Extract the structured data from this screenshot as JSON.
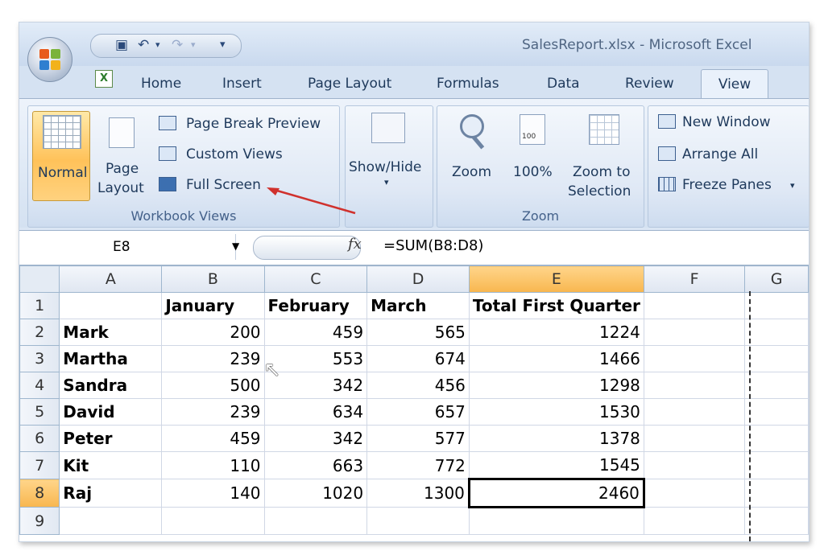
{
  "window": {
    "title": "SalesReport.xlsx - Microsoft Excel"
  },
  "quick_access": {
    "save_icon": "save-icon",
    "undo_icon": "undo-icon",
    "redo_icon": "redo-icon",
    "customize_icon": "customize-icon"
  },
  "tabs": [
    "Home",
    "Insert",
    "Page Layout",
    "Formulas",
    "Data",
    "Review",
    "View"
  ],
  "active_tab": "View",
  "ribbon": {
    "workbook_views": {
      "label": "Workbook Views",
      "normal": "Normal",
      "page_layout_line1": "Page",
      "page_layout_line2": "Layout",
      "page_break_preview": "Page Break Preview",
      "custom_views": "Custom Views",
      "full_screen": "Full Screen"
    },
    "show_hide": {
      "label": "Show/Hide"
    },
    "zoom": {
      "label": "Zoom",
      "zoom": "Zoom",
      "hundred": "100%",
      "hundred_icon_text": "100",
      "zoom_to_selection_line1": "Zoom to",
      "zoom_to_selection_line2": "Selection"
    },
    "window": {
      "new_window": "New Window",
      "arrange_all": "Arrange All",
      "freeze_panes": "Freeze Panes"
    }
  },
  "formula_bar": {
    "name_box": "E8",
    "fx": "fx",
    "formula": "=SUM(B8:D8)"
  },
  "sheet": {
    "columns": [
      "A",
      "B",
      "C",
      "D",
      "E",
      "F",
      "G"
    ],
    "selected_column": "E",
    "selected_row": "8",
    "rows": [
      {
        "n": "1",
        "a": "",
        "b": "January",
        "c": "February",
        "d": "March",
        "e": "Total First Quarter"
      },
      {
        "n": "2",
        "a": "Mark",
        "b": "200",
        "c": "459",
        "d": "565",
        "e": "1224"
      },
      {
        "n": "3",
        "a": "Martha",
        "b": "239",
        "c": "553",
        "d": "674",
        "e": "1466"
      },
      {
        "n": "4",
        "a": "Sandra",
        "b": "500",
        "c": "342",
        "d": "456",
        "e": "1298"
      },
      {
        "n": "5",
        "a": "David",
        "b": "239",
        "c": "634",
        "d": "657",
        "e": "1530"
      },
      {
        "n": "6",
        "a": "Peter",
        "b": "459",
        "c": "342",
        "d": "577",
        "e": "1378"
      },
      {
        "n": "7",
        "a": "Kit",
        "b": "110",
        "c": "663",
        "d": "772",
        "e": "1545"
      },
      {
        "n": "8",
        "a": "Raj",
        "b": "140",
        "c": "1020",
        "d": "1300",
        "e": "2460"
      },
      {
        "n": "9",
        "a": "",
        "b": "",
        "c": "",
        "d": "",
        "e": ""
      }
    ]
  },
  "colors": {
    "accent": "#ffc25a",
    "ribbon": "#dbe6f4",
    "annotation_arrow": "#d0312d"
  }
}
